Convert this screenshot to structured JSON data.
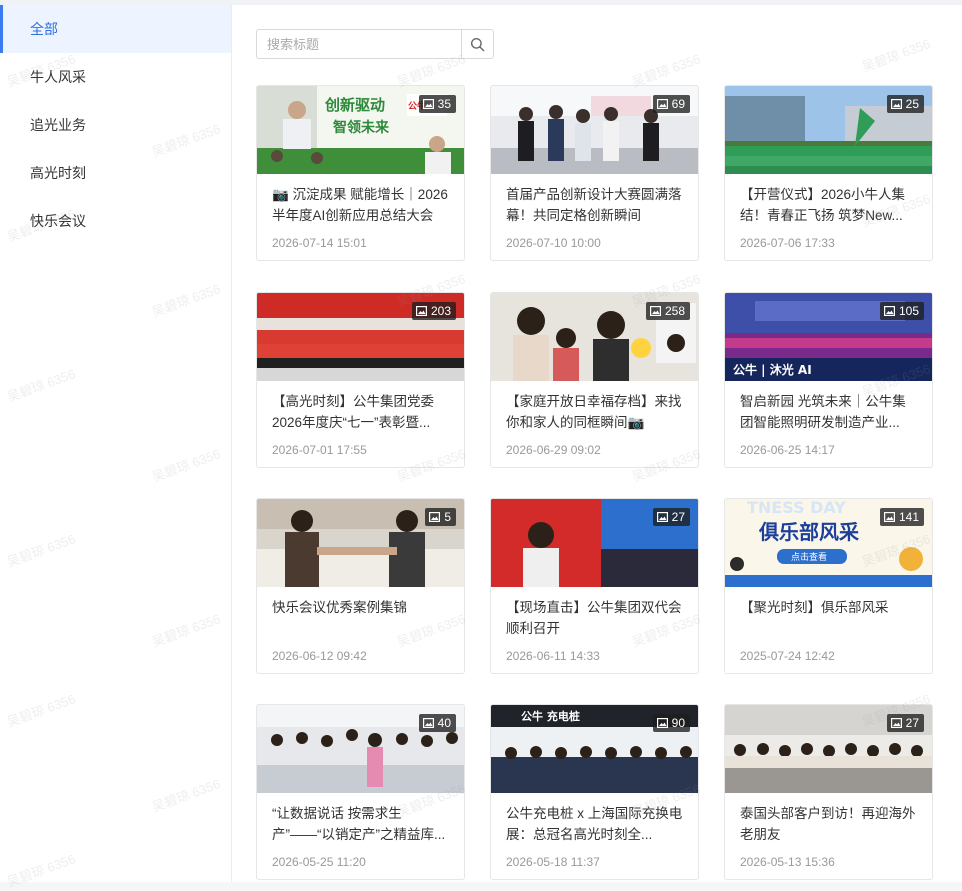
{
  "sidebar": {
    "items": [
      {
        "label": "全部",
        "active": true
      },
      {
        "label": "牛人风采",
        "active": false
      },
      {
        "label": "追光业务",
        "active": false
      },
      {
        "label": "高光时刻",
        "active": false
      },
      {
        "label": "快乐会议",
        "active": false
      }
    ]
  },
  "search": {
    "placeholder": "搜索标题",
    "value": ""
  },
  "watermark": "吴碧琼 6356",
  "icons": {
    "search": "search-icon",
    "photo": "image-icon"
  },
  "cards": [
    {
      "title": "📷 沉淀成果 赋能增长｜2026半年度AI创新应用总结大会",
      "date": "2026-07-14 15:01",
      "count": "35"
    },
    {
      "title": "首届产品创新设计大赛圆满落幕！共同定格创新瞬间",
      "date": "2026-07-10 10:00",
      "count": "69"
    },
    {
      "title": "【开营仪式】2026小牛人集结！青春正飞扬 筑梦New...",
      "date": "2026-07-06 17:33",
      "count": "25"
    },
    {
      "title": "【高光时刻】公牛集团党委2026年度庆“七一”表彰暨...",
      "date": "2026-07-01 17:55",
      "count": "203"
    },
    {
      "title": "【家庭开放日幸福存档】来找你和家人的同框瞬间📷",
      "date": "2026-06-29 09:02",
      "count": "258"
    },
    {
      "title": "智启新园 光筑未来｜公牛集团智能照明研发制造产业...",
      "date": "2026-06-25 14:17",
      "count": "105"
    },
    {
      "title": "快乐会议优秀案例集锦",
      "date": "2026-06-12 09:42",
      "count": "5"
    },
    {
      "title": "【现场直击】公牛集团双代会顺利召开",
      "date": "2026-06-11 14:33",
      "count": "27"
    },
    {
      "title": "【聚光时刻】俱乐部风采",
      "date": "2025-07-24 12:42",
      "count": "141"
    },
    {
      "title": "“让数据说话 按需求生产”——“以销定产”之精益库...",
      "date": "2026-05-25 11:20",
      "count": "40"
    },
    {
      "title": "公牛充电桩 x 上海国际充换电展：总冠名高光时刻全...",
      "date": "2026-05-18 11:37",
      "count": "90"
    },
    {
      "title": "泰国头部客户到访！再迎海外老朋友",
      "date": "2026-05-13 15:36",
      "count": "27"
    }
  ],
  "thumb_text": {
    "c1": {
      "line1": "创新驱动",
      "line2": "智领未来"
    },
    "c6": {
      "text": "公牛 | 沐光 AI"
    },
    "c9": {
      "line1": "俱乐部风采",
      "btn": "点击查看",
      "banner": "TNESS DAY"
    },
    "c11": {
      "text": "公牛 充电桩"
    }
  },
  "colors": {
    "accent": "#3b7bf0",
    "active_bg": "#eef4ff",
    "brand_red": "#d9242a"
  }
}
